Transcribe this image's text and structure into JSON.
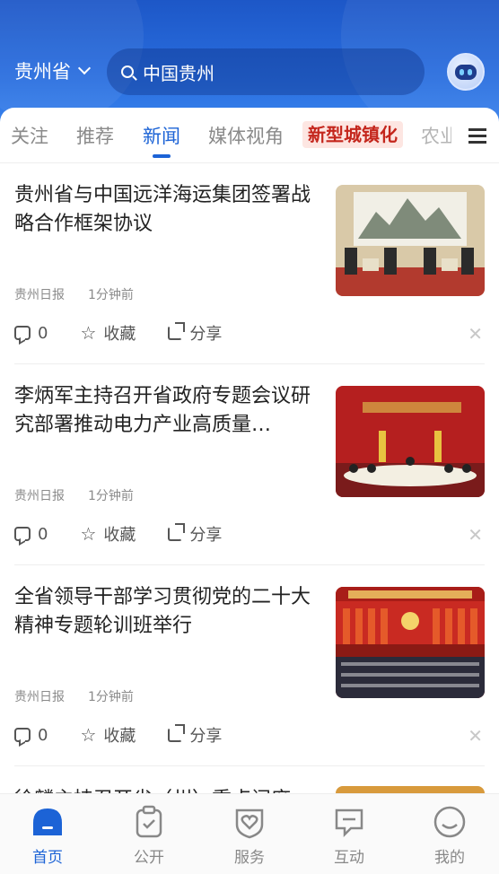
{
  "header": {
    "province": "贵州省",
    "search_placeholder": "中国贵州"
  },
  "tabs": [
    {
      "label": "关注",
      "active": false
    },
    {
      "label": "推荐",
      "active": false
    },
    {
      "label": "新闻",
      "active": true
    },
    {
      "label": "媒体视角",
      "active": false
    },
    {
      "label": "新型城镇化",
      "active": false
    },
    {
      "label": "农业",
      "active": false
    }
  ],
  "articles": [
    {
      "title": "贵州省与中国远洋海运集团签署战略合作框架协议",
      "source": "贵州日报",
      "time": "1分钟前",
      "comments": "0",
      "collect_label": "收藏",
      "share_label": "分享"
    },
    {
      "title": "李炳军主持召开省政府专题会议研究部署推动电力产业高质量…",
      "source": "贵州日报",
      "time": "1分钟前",
      "comments": "0",
      "collect_label": "收藏",
      "share_label": "分享"
    },
    {
      "title": "全省领导干部学习贯彻党的二十大精神专题轮训班举行",
      "source": "贵州日报",
      "time": "1分钟前",
      "comments": "0",
      "collect_label": "收藏",
      "share_label": "分享"
    }
  ],
  "partial_article_title": "徐麟主持召开省（州）重点问席",
  "bottom_nav": [
    {
      "label": "首页",
      "icon": "home-icon",
      "active": true
    },
    {
      "label": "公开",
      "icon": "clipboard-check-icon",
      "active": false
    },
    {
      "label": "服务",
      "icon": "heart-shield-icon",
      "active": false
    },
    {
      "label": "互动",
      "icon": "chat-bubble-icon",
      "active": false
    },
    {
      "label": "我的",
      "icon": "smiley-profile-icon",
      "active": false
    }
  ],
  "colors": {
    "brand_blue": "#1c63d6",
    "header_blue": "#2a6fe0",
    "highlight_red": "#c4261c"
  }
}
